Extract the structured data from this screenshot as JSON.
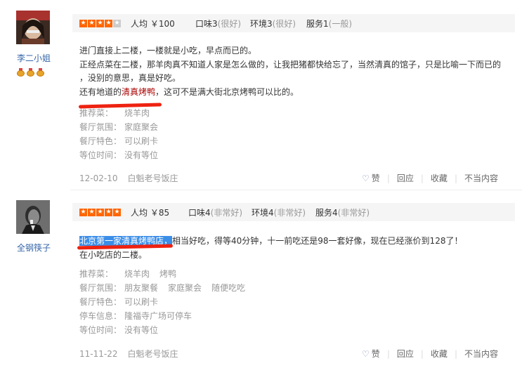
{
  "reviews": [
    {
      "username": "李二小姐",
      "rating_stars": 4,
      "avg_price": "人均 ￥100",
      "taste": "口味3",
      "taste_q": "(很好)",
      "env": "环境3",
      "env_q": "(很好)",
      "service": "服务1",
      "service_q": "(一般)",
      "lines": [
        "进门直接上二楼，一楼就是小吃，早点而已的。",
        "正经点菜在二楼，那羊肉真不知道人家是怎么做的，让我把猪都快给忘了，当然清真的馆子，只是比喻一下而已的",
        "，没别的意思，真是好吃。"
      ],
      "line4_pre": "还有地道的",
      "line4_hl": "清真烤鸭",
      "line4_post": "，这可不是满大街北京烤鸭可以比的。",
      "info": [
        {
          "key": "推荐菜：",
          "vals": [
            "烧羊肉"
          ]
        },
        {
          "key": "餐厅氛围：",
          "vals": [
            "家庭聚会"
          ]
        },
        {
          "key": "餐厅特色：",
          "vals": [
            "可以刷卡"
          ]
        },
        {
          "key": "等位时间：",
          "vals": [
            "没有等位"
          ]
        }
      ],
      "date": "12-02-10",
      "shop": "白魁老号饭庄"
    },
    {
      "username": "全钢筷子",
      "rating_stars": 5,
      "avg_price": "人均 ￥85",
      "taste": "口味4",
      "taste_q": "(非常好)",
      "env": "环境4",
      "env_q": "(非常好)",
      "service": "服务4",
      "service_q": "(非常好)",
      "line1_hl": "北京第一家清真烤鸭店，",
      "line1_post": "相当好吃，得等40分钟，十一前吃还是98一套好像，现在已经涨价到128了！",
      "line2": "在小吃店的二楼。",
      "info": [
        {
          "key": "推荐菜：",
          "vals": [
            "烧羊肉",
            "烤鸭"
          ]
        },
        {
          "key": "餐厅氛围：",
          "vals": [
            "朋友聚餐",
            "家庭聚会",
            "随便吃吃"
          ]
        },
        {
          "key": "餐厅特色：",
          "vals": [
            "可以刷卡"
          ]
        },
        {
          "key": "停车信息：",
          "vals": [
            "隆福寺广场可停车"
          ]
        },
        {
          "key": "等位时间：",
          "vals": [
            "没有等位"
          ]
        }
      ],
      "date": "11-11-22",
      "shop": "白魁老号饭庄"
    }
  ],
  "actions": {
    "like": "赞",
    "reply": "回应",
    "favorite": "收藏",
    "inappropriate": "不当内容"
  },
  "colors": {
    "star": "#ff6600",
    "username": "#3565a8",
    "annotation": "#ee2211",
    "selection": "#3b8ee8"
  }
}
